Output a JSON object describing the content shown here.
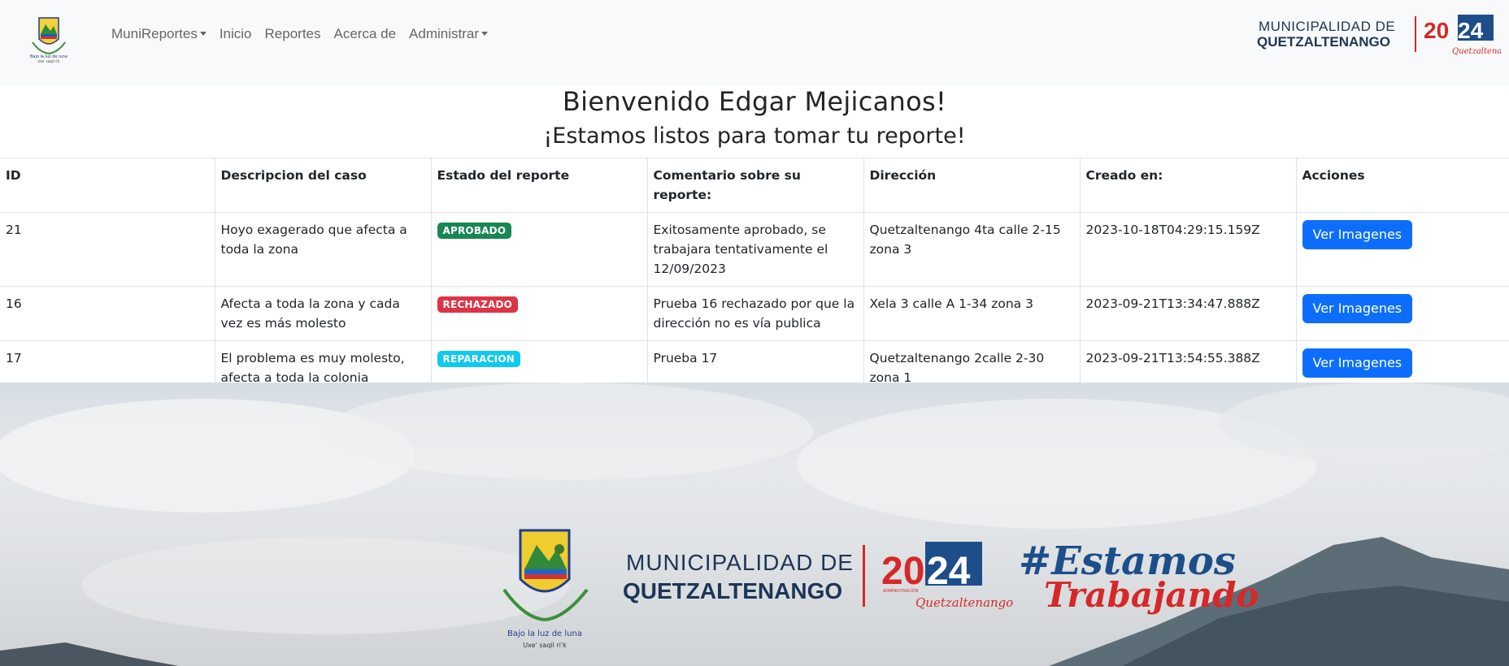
{
  "nav": {
    "items": [
      {
        "label": "MuniReportes",
        "dropdown": true
      },
      {
        "label": "Inicio",
        "dropdown": false
      },
      {
        "label": "Reportes",
        "dropdown": false
      },
      {
        "label": "Acerca de",
        "dropdown": false
      },
      {
        "label": "Administrar",
        "dropdown": true
      }
    ],
    "logo_text_top": "Bajo la luz de luna",
    "logo_text_bottom": "Uxe' saqil ri'k",
    "brand_line1": "MUNICIPALIDAD DE",
    "brand_line2": "QUETZALTENANGO",
    "brand_year_a": "20",
    "brand_year_b": "24",
    "brand_script": "Quetzaltenango"
  },
  "welcome": "Bienvenido Edgar Mejicanos!",
  "subtitle": "¡Estamos listos para tomar tu reporte!",
  "table": {
    "headers": [
      "ID",
      "Descripcion del caso",
      "Estado del reporte",
      "Comentario sobre su reporte:",
      "Dirección",
      "Creado en:",
      "Acciones"
    ],
    "rows": [
      {
        "id": "21",
        "description": "Hoyo exagerado que afecta a toda la zona",
        "status": "APROBADO",
        "comment": "Exitosamente aprobado, se trabajara tentativamente el 12/09/2023",
        "address": "Quetzaltenango 4ta calle 2-15 zona 3",
        "created": "2023-10-18T04:29:15.159Z",
        "action": "Ver Imagenes"
      },
      {
        "id": "16",
        "description": "Afecta a toda la zona y cada vez es más molesto",
        "status": "RECHAZADO",
        "comment": "Prueba 16 rechazado por que la dirección no es vía publica",
        "address": "Xela 3 calle A 1-34 zona 3",
        "created": "2023-09-21T13:34:47.888Z",
        "action": "Ver Imagenes"
      },
      {
        "id": "17",
        "description": "El problema es muy molesto, afecta a toda la colonia",
        "status": "REPARACION",
        "comment": "Prueba 17",
        "address": "Quetzaltenango 2calle 2-30 zona 1",
        "created": "2023-09-21T13:54:55.388Z",
        "action": "Ver Imagenes"
      }
    ]
  },
  "banner": {
    "line1": "MUNICIPALIDAD DE",
    "line2": "QUETZALTENANGO",
    "year_a": "20",
    "year_b": "24",
    "admin": "ADMINISTRACIÓN",
    "script": "Quetzaltenango",
    "hashtag": "#Estamos",
    "hashtag2": "Trabajando",
    "seal_motto": "Bajo la luz de luna",
    "seal_sub": "Uxe' saqil ri'k"
  },
  "colors": {
    "navy": "#1d3557",
    "red": "#d62828",
    "primary": "#0d6efd",
    "success": "#198754",
    "danger": "#dc3545",
    "info": "#0dcaf0"
  }
}
